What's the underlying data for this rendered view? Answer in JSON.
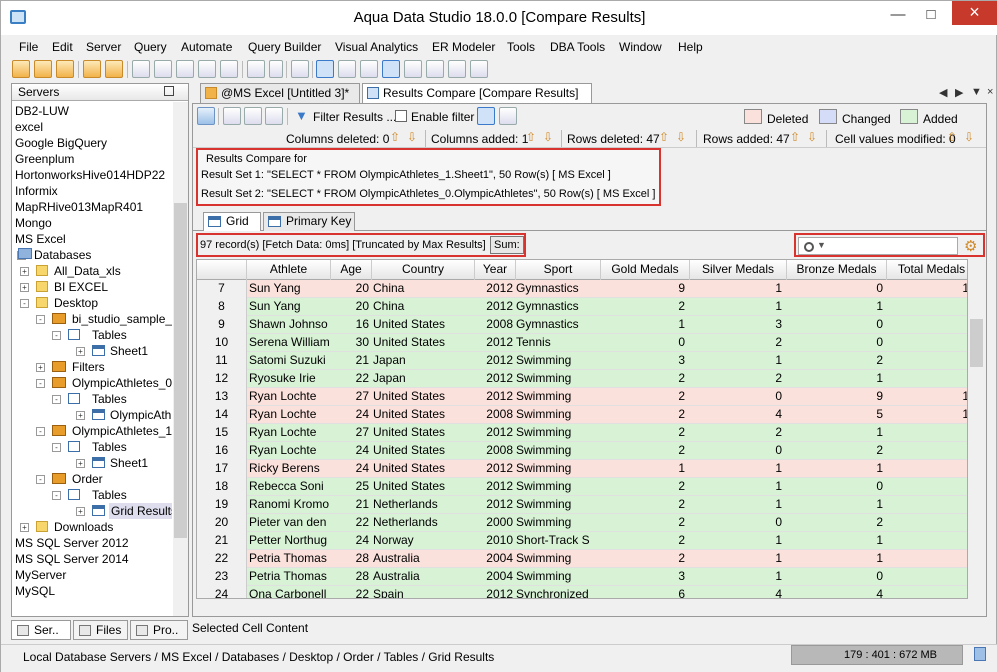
{
  "window": {
    "title": "Aqua Data Studio 18.0.0 [Compare Results]"
  },
  "menu": [
    "File",
    "Edit",
    "Server",
    "Query",
    "Automate",
    "Query Builder",
    "Visual Analytics",
    "ER Modeler",
    "Tools",
    "DBA Tools",
    "Window",
    "Help"
  ],
  "servers_panel": {
    "title": "Servers",
    "items": [
      "DB2-LUW",
      "excel",
      "Google BigQuery",
      "Greenplum",
      "HortonworksHive014HDP22",
      "Informix",
      "MapRHive013MapR401",
      "Mongo",
      "MS Excel",
      "Databases",
      "All_Data_xls",
      "BI EXCEL",
      "Desktop",
      "bi_studio_sample_da",
      "Tables",
      "Sheet1",
      "Filters",
      "OlympicAthletes_0",
      "Tables",
      "OlympicAthle",
      "OlympicAthletes_1",
      "Tables",
      "Sheet1",
      "Order",
      "Tables",
      "Grid Results",
      "Downloads",
      "MS SQL Server 2012",
      "MS SQL Server 2014",
      "MyServer",
      "MySQL"
    ]
  },
  "bottom_tabs": [
    "Ser..",
    "Files",
    "Pro.."
  ],
  "editor_tabs": [
    "@MS Excel [Untitled 3]*",
    "Results Compare [Compare Results]"
  ],
  "compare_toolbar": {
    "filter_label": "Filter Results ...",
    "enable_filter": "Enable filter",
    "legend": [
      {
        "label": "Deleted",
        "color": "#fbe1dc"
      },
      {
        "label": "Changed",
        "color": "#d4dcf7"
      },
      {
        "label": "Added",
        "color": "#d8f2d6"
      }
    ]
  },
  "stats": {
    "columns_deleted": "Columns deleted: 0",
    "columns_added": "Columns added: 1",
    "rows_deleted": "Rows deleted: 47",
    "rows_added": "Rows added: 47",
    "cells_modified": "Cell values modified: 0"
  },
  "results_compare": {
    "heading": "Results Compare for",
    "set1": "Result Set 1: \"SELECT * FROM OlympicAthletes_1.Sheet1\", 50 Row(s)  [ MS Excel ]",
    "set2": "Result Set 2: \"SELECT * FROM OlympicAthletes_0.OlympicAthletes\", 50 Row(s)  [ MS Excel ]"
  },
  "sub_tabs": [
    "Grid",
    "Primary Key"
  ],
  "info": {
    "records": "97 record(s) [Fetch Data: 0ms]  [Truncated by Max Results]",
    "sum_label": "Sum:"
  },
  "search": {
    "placeholder": ""
  },
  "grid": {
    "columns": [
      "",
      "Athlete",
      "Age",
      "Country",
      "Year",
      "Sport",
      "Gold Medals",
      "Silver Medals",
      "Bronze Medals",
      "Total Medals"
    ],
    "rows": [
      {
        "n": "7",
        "athlete": "Sun Yang",
        "age": "20",
        "country": "China",
        "year": "2012",
        "sport": "Gymnastics",
        "gold": "9",
        "silver": "1",
        "bronze": "0",
        "total": "1",
        "status": "deleted"
      },
      {
        "n": "8",
        "athlete": "Sun Yang",
        "age": "20",
        "country": "China",
        "year": "2012",
        "sport": "Gymnastics",
        "gold": "2",
        "silver": "1",
        "bronze": "1",
        "total": "",
        "status": "added"
      },
      {
        "n": "9",
        "athlete": "Shawn Johnso",
        "age": "16",
        "country": "United States",
        "year": "2008",
        "sport": "Gymnastics",
        "gold": "1",
        "silver": "3",
        "bronze": "0",
        "total": "",
        "status": "added"
      },
      {
        "n": "10",
        "athlete": "Serena William",
        "age": "30",
        "country": "United States",
        "year": "2012",
        "sport": "Tennis",
        "gold": "0",
        "silver": "2",
        "bronze": "0",
        "total": "",
        "status": "added"
      },
      {
        "n": "11",
        "athlete": "Satomi Suzuki",
        "age": "21",
        "country": "Japan",
        "year": "2012",
        "sport": "Swimming",
        "gold": "3",
        "silver": "1",
        "bronze": "2",
        "total": "",
        "status": "added"
      },
      {
        "n": "12",
        "athlete": "Ryosuke Irie",
        "age": "22",
        "country": "Japan",
        "year": "2012",
        "sport": "Swimming",
        "gold": "2",
        "silver": "2",
        "bronze": "1",
        "total": "",
        "status": "added"
      },
      {
        "n": "13",
        "athlete": "Ryan Lochte",
        "age": "27",
        "country": "United States",
        "year": "2012",
        "sport": "Swimming",
        "gold": "2",
        "silver": "0",
        "bronze": "9",
        "total": "1",
        "status": "deleted"
      },
      {
        "n": "14",
        "athlete": "Ryan Lochte",
        "age": "24",
        "country": "United States",
        "year": "2008",
        "sport": "Swimming",
        "gold": "2",
        "silver": "4",
        "bronze": "5",
        "total": "1",
        "status": "deleted"
      },
      {
        "n": "15",
        "athlete": "Ryan Lochte",
        "age": "27",
        "country": "United States",
        "year": "2012",
        "sport": "Swimming",
        "gold": "2",
        "silver": "2",
        "bronze": "1",
        "total": "",
        "status": "added"
      },
      {
        "n": "16",
        "athlete": "Ryan Lochte",
        "age": "24",
        "country": "United States",
        "year": "2008",
        "sport": "Swimming",
        "gold": "2",
        "silver": "0",
        "bronze": "2",
        "total": "",
        "status": "added"
      },
      {
        "n": "17",
        "athlete": "Ricky Berens",
        "age": "24",
        "country": "United States",
        "year": "2012",
        "sport": "Swimming",
        "gold": "1",
        "silver": "1",
        "bronze": "1",
        "total": "",
        "status": "deleted"
      },
      {
        "n": "18",
        "athlete": "Rebecca Soni",
        "age": "25",
        "country": "United States",
        "year": "2012",
        "sport": "Swimming",
        "gold": "2",
        "silver": "1",
        "bronze": "0",
        "total": "",
        "status": "added"
      },
      {
        "n": "19",
        "athlete": "Ranomi Kromo",
        "age": "21",
        "country": "Netherlands",
        "year": "2012",
        "sport": "Swimming",
        "gold": "2",
        "silver": "1",
        "bronze": "1",
        "total": "",
        "status": "added"
      },
      {
        "n": "20",
        "athlete": "Pieter van den",
        "age": "22",
        "country": "Netherlands",
        "year": "2000",
        "sport": "Swimming",
        "gold": "2",
        "silver": "0",
        "bronze": "2",
        "total": "",
        "status": "added"
      },
      {
        "n": "21",
        "athlete": "Petter Northug",
        "age": "24",
        "country": "Norway",
        "year": "2010",
        "sport": "Short-Track S",
        "gold": "2",
        "silver": "1",
        "bronze": "1",
        "total": "",
        "status": "added"
      },
      {
        "n": "22",
        "athlete": "Petria Thomas",
        "age": "28",
        "country": "Australia",
        "year": "2004",
        "sport": "Swimming",
        "gold": "2",
        "silver": "1",
        "bronze": "1",
        "total": "",
        "status": "deleted"
      },
      {
        "n": "23",
        "athlete": "Petria Thomas",
        "age": "28",
        "country": "Australia",
        "year": "2004",
        "sport": "Swimming",
        "gold": "3",
        "silver": "1",
        "bronze": "0",
        "total": "",
        "status": "added"
      },
      {
        "n": "24",
        "athlete": "Ona Carbonell",
        "age": "22",
        "country": "Spain",
        "year": "2012",
        "sport": "Synchronized",
        "gold": "6",
        "silver": "4",
        "bronze": "4",
        "total": "",
        "status": "added"
      }
    ]
  },
  "selected_cell_label": "Selected Cell Content",
  "statusbar": {
    "path": "Local Database Servers / MS Excel / Databases / Desktop / Order / Tables / Grid Results",
    "memory": "179 : 401 : 672 MB"
  }
}
